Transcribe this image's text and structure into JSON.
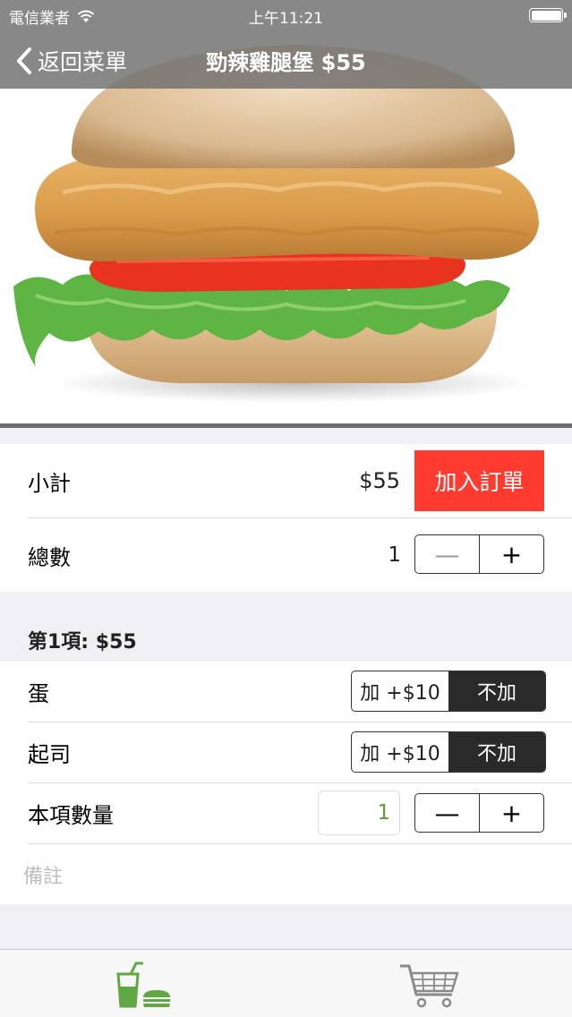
{
  "status_bar": {
    "carrier": "電信業者",
    "time": "上午11:21"
  },
  "nav": {
    "back_label": "返回菜單",
    "title": "勁辣雞腿堡 $55"
  },
  "summary": {
    "subtotal_label": "小計",
    "subtotal_value": "$55",
    "add_to_order_label": "加入訂單",
    "total_label": "總數",
    "total_count": "1",
    "minus": "—",
    "plus": "+"
  },
  "item": {
    "header": "第1項: $55",
    "options": [
      {
        "label": "蛋",
        "add": "加 +$10",
        "none": "不加",
        "selected": "none"
      },
      {
        "label": "起司",
        "add": "加 +$10",
        "none": "不加",
        "selected": "none"
      }
    ],
    "qty_label": "本項數量",
    "qty_value": "1",
    "minus": "—",
    "plus": "+",
    "notes_placeholder": "備註"
  },
  "tabs": [
    {
      "icon": "menu-icon",
      "active": true,
      "color": "#5fa843"
    },
    {
      "icon": "cart-icon",
      "active": false,
      "color": "#8a8a8a"
    }
  ],
  "colors": {
    "accent_red": "#ff3b30",
    "dark": "#2a2a2a",
    "green": "#5fa843"
  }
}
